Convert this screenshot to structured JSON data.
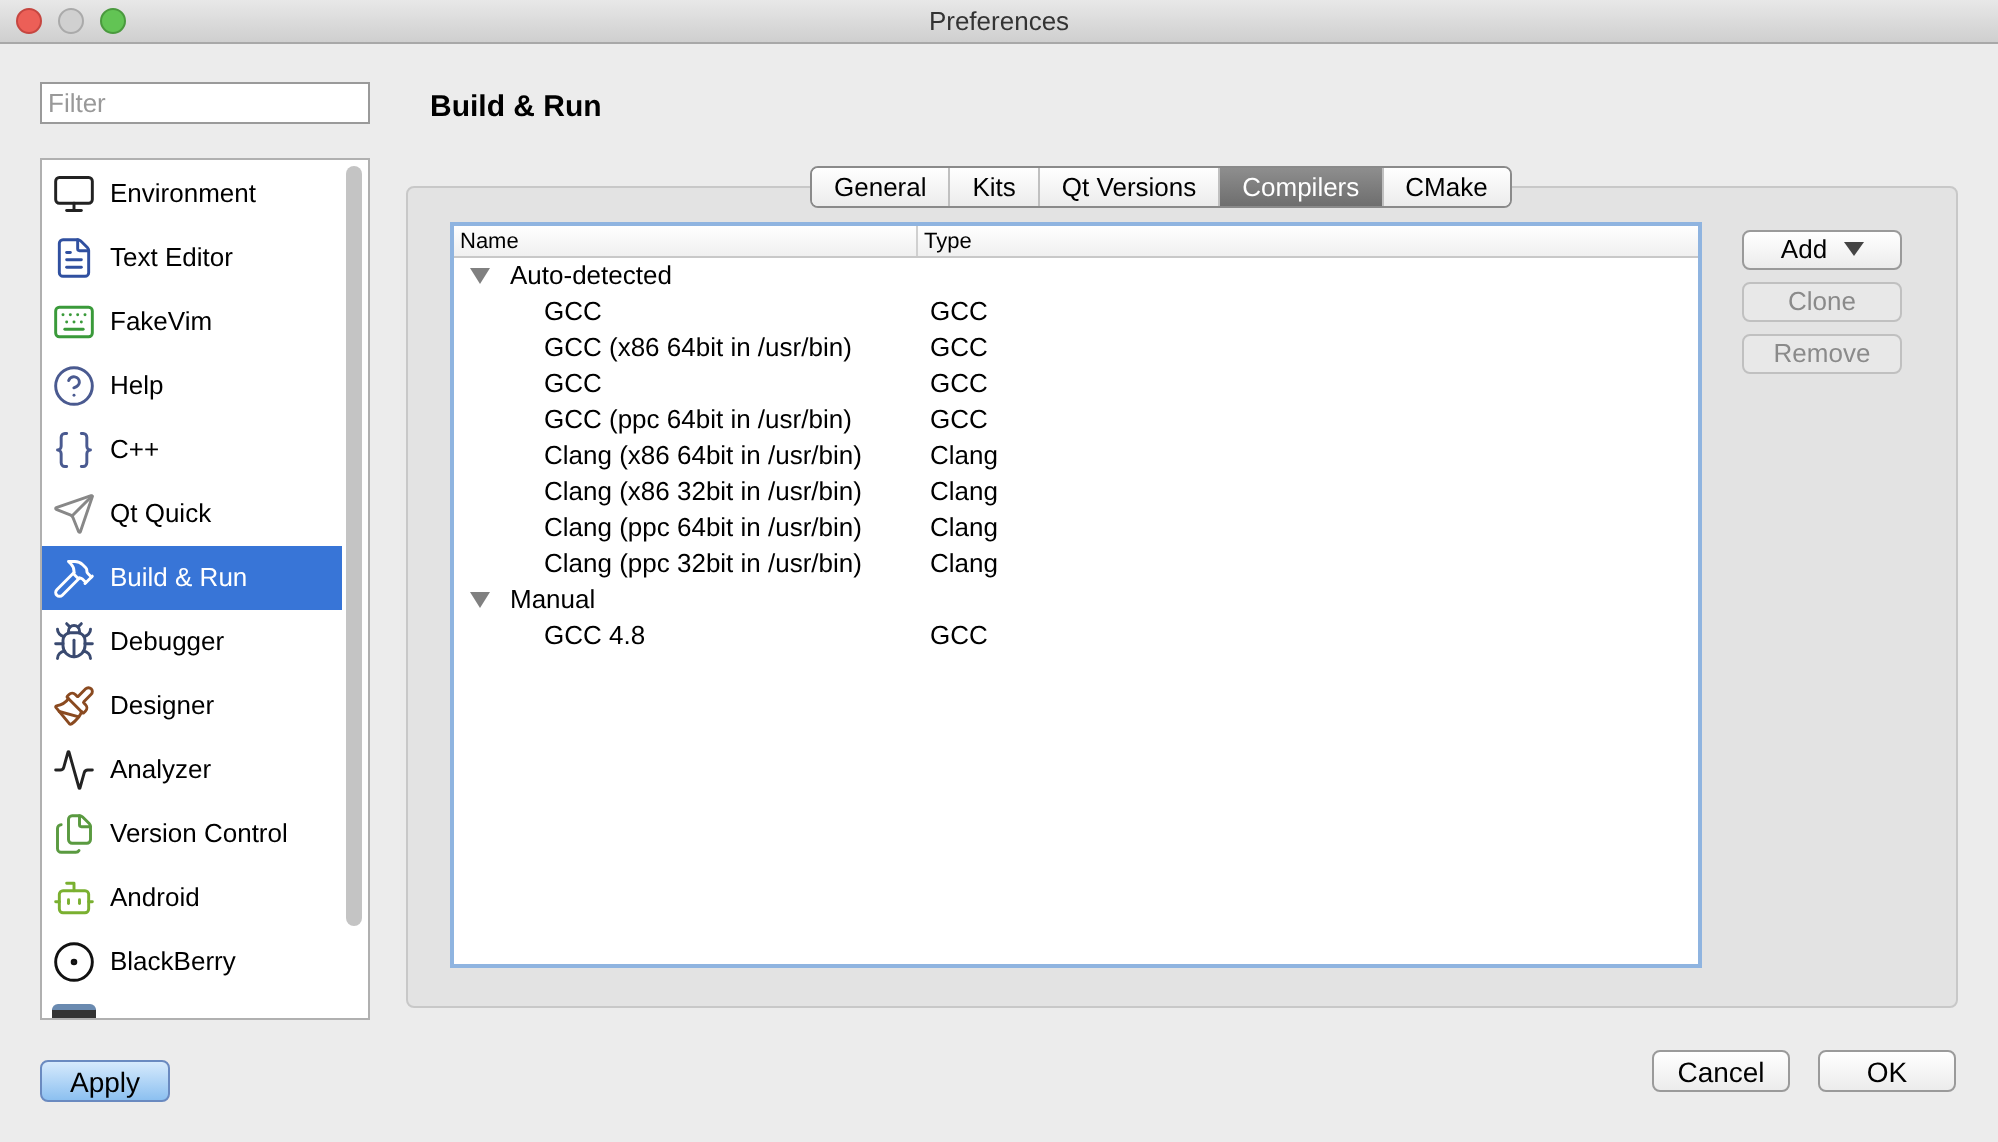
{
  "window": {
    "title": "Preferences"
  },
  "filter": {
    "placeholder": "Filter"
  },
  "sidebar": {
    "items": [
      {
        "label": "Environment",
        "selected": false
      },
      {
        "label": "Text Editor",
        "selected": false
      },
      {
        "label": "FakeVim",
        "selected": false
      },
      {
        "label": "Help",
        "selected": false
      },
      {
        "label": "C++",
        "selected": false
      },
      {
        "label": "Qt Quick",
        "selected": false
      },
      {
        "label": "Build & Run",
        "selected": true
      },
      {
        "label": "Debugger",
        "selected": false
      },
      {
        "label": "Designer",
        "selected": false
      },
      {
        "label": "Analyzer",
        "selected": false
      },
      {
        "label": "Version Control",
        "selected": false
      },
      {
        "label": "Android",
        "selected": false
      },
      {
        "label": "BlackBerry",
        "selected": false
      }
    ]
  },
  "page_title": "Build & Run",
  "tabs": [
    {
      "label": "General",
      "selected": false
    },
    {
      "label": "Kits",
      "selected": false
    },
    {
      "label": "Qt Versions",
      "selected": false
    },
    {
      "label": "Compilers",
      "selected": true
    },
    {
      "label": "CMake",
      "selected": false
    }
  ],
  "tree": {
    "columns": [
      "Name",
      "Type"
    ],
    "groups": [
      {
        "label": "Auto-detected",
        "expanded": true,
        "children": [
          {
            "name": "GCC",
            "type": "GCC"
          },
          {
            "name": "GCC (x86 64bit in /usr/bin)",
            "type": "GCC"
          },
          {
            "name": "GCC",
            "type": "GCC"
          },
          {
            "name": "GCC (ppc 64bit in /usr/bin)",
            "type": "GCC"
          },
          {
            "name": "Clang (x86 64bit in /usr/bin)",
            "type": "Clang"
          },
          {
            "name": "Clang (x86 32bit in /usr/bin)",
            "type": "Clang"
          },
          {
            "name": "Clang (ppc 64bit in /usr/bin)",
            "type": "Clang"
          },
          {
            "name": "Clang (ppc 32bit in /usr/bin)",
            "type": "Clang"
          }
        ]
      },
      {
        "label": "Manual",
        "expanded": true,
        "children": [
          {
            "name": "GCC 4.8",
            "type": "GCC"
          }
        ]
      }
    ]
  },
  "side_buttons": [
    {
      "label": "Add",
      "kind": "menu",
      "disabled": false
    },
    {
      "label": "Clone",
      "kind": "plain",
      "disabled": true
    },
    {
      "label": "Remove",
      "kind": "plain",
      "disabled": true
    }
  ],
  "apply_button": "Apply",
  "dialog_buttons": [
    "Cancel",
    "OK"
  ]
}
